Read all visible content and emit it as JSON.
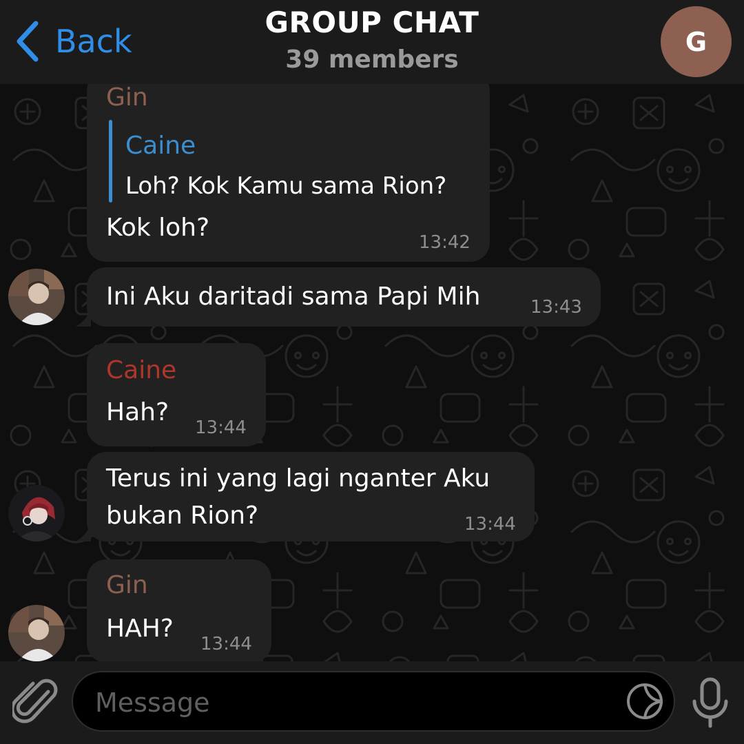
{
  "header": {
    "back_label": "Back",
    "title": "GROUP CHAT",
    "subtitle": "39 members",
    "avatar_letter": "G",
    "avatar_color": "#8d6052"
  },
  "colors": {
    "accent": "#2f8fe8",
    "bubble": "#212121",
    "gin": "#8d6052",
    "caine_red": "#b0362c",
    "caine_blue": "#3b8ed0"
  },
  "messages": [
    {
      "sender": "Gin",
      "reply": {
        "name": "Caine",
        "text": "Loh? Kok Kamu sama Rion?"
      },
      "text": "Kok loh?",
      "time": "13:42"
    },
    {
      "text": "Ini Aku daritadi sama Papi Mih",
      "time": "13:43"
    },
    {
      "sender": "Caine",
      "text": "Hah?",
      "time": "13:44"
    },
    {
      "lines": [
        "Terus ini yang lagi nganter Aku",
        "bukan Rion?"
      ],
      "time": "13:44"
    },
    {
      "sender": "Gin",
      "text": "HAH?",
      "time": "13:44"
    }
  ],
  "input": {
    "placeholder": "Message"
  },
  "icons": {
    "back": "chevron-left-icon",
    "attach": "paperclip-icon",
    "sticker": "sticker-icon",
    "mic": "microphone-icon"
  }
}
